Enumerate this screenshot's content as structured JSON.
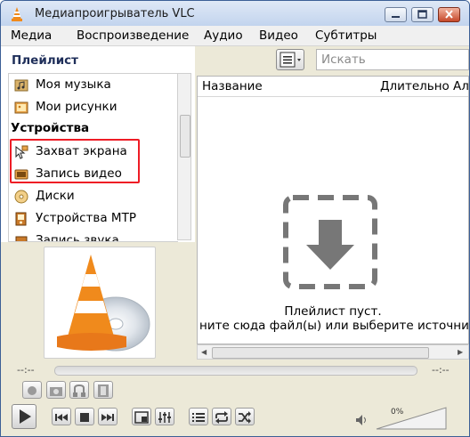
{
  "window": {
    "title": "Медиапроигрыватель VLC"
  },
  "menu": [
    "Медиа",
    "Воспроизведение",
    "Аудио",
    "Видео",
    "Субтитры"
  ],
  "sidebar": {
    "header": "Плейлист",
    "items": [
      {
        "label": "Моя музыка",
        "icon": "music-folder-icon"
      },
      {
        "label": "Мои рисунки",
        "icon": "pictures-folder-icon"
      }
    ],
    "group_devices": "Устройства",
    "devices": [
      {
        "label": "Захват экрана",
        "icon": "screen-capture-icon"
      },
      {
        "label": "Запись видео",
        "icon": "video-capture-icon"
      },
      {
        "label": "Диски",
        "icon": "disc-icon"
      },
      {
        "label": "Устройства MTP",
        "icon": "mtp-device-icon"
      },
      {
        "label": "Запись звука",
        "icon": "audio-capture-icon"
      }
    ]
  },
  "playlist": {
    "search_placeholder": "Искать",
    "columns": [
      "Название",
      "Длительность",
      "Альбом"
    ],
    "empty_line1": "Плейлист пуст.",
    "empty_line2": "ните сюда файл(ы) или выберите источни"
  },
  "seek": {
    "elapsed": "--:--",
    "remaining": "--:--"
  },
  "volume": {
    "percent_label": "0%",
    "level": 0
  },
  "colors": {
    "highlight": "#ee1c25",
    "vlc_orange": "#f08a1c"
  }
}
